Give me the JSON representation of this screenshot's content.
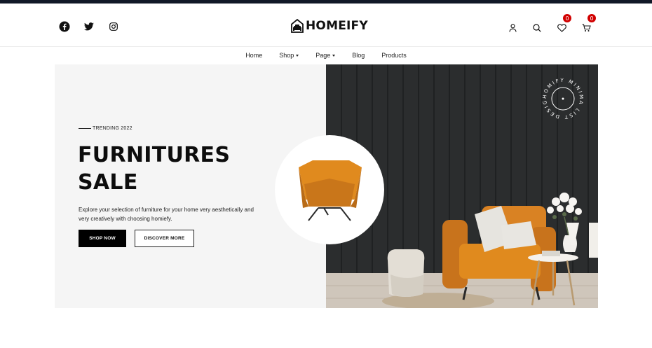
{
  "header": {
    "social": [
      {
        "icon": "facebook-icon"
      },
      {
        "icon": "twitter-icon"
      },
      {
        "icon": "instagram-icon"
      }
    ],
    "logo_text": "HOMEIFY",
    "actions": [
      {
        "icon": "user-icon"
      },
      {
        "icon": "search-icon"
      },
      {
        "icon": "heart-icon",
        "badge": "0"
      },
      {
        "icon": "cart-icon",
        "badge": "0"
      }
    ]
  },
  "nav": {
    "items": [
      {
        "label": "Home"
      },
      {
        "label": "Shop"
      },
      {
        "label": "Page"
      },
      {
        "label": "Blog"
      },
      {
        "label": "Products"
      }
    ]
  },
  "hero": {
    "eyebrow": "TRENDING 2022",
    "headline_line1": "FURNITURES",
    "headline_line2": "SALE",
    "description": "Explore your selection of furniture for your home very aesthetically and very creatively with choosing homiefy.",
    "primary_button": "SHOP NOW",
    "secondary_button": "DISCOVER MORE",
    "stamp_text": "HOMIFY MINIMA LIST DESIGN"
  },
  "colors": {
    "topbar": "#111827",
    "badge": "#d10000",
    "chair_orange": "#e08a1e",
    "wall_dark": "#2b2d2e"
  }
}
